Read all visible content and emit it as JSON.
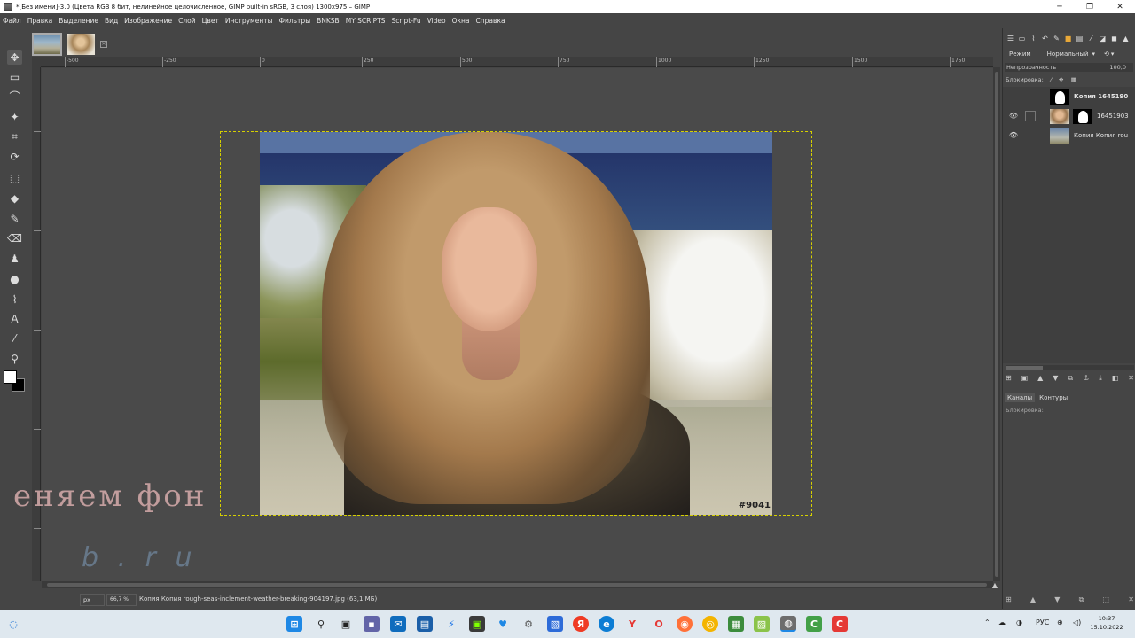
{
  "window": {
    "title": "*[Без имени]-3.0 (Цвета RGB 8 бит, нелинейное целочисленное, GIMP built-in sRGB, 3 слоя) 1300x975 – GIMP",
    "minimize": "─",
    "maximize": "❐",
    "close": "✕"
  },
  "menu": [
    "Файл",
    "Правка",
    "Выделение",
    "Вид",
    "Изображение",
    "Слой",
    "Цвет",
    "Инструменты",
    "Фильтры",
    "BNKSB",
    "MY SCRIPTS",
    "Script-Fu",
    "Video",
    "Окна",
    "Справка"
  ],
  "tab_close": "✕",
  "tools": [
    {
      "name": "move-tool-icon",
      "glyph": "✥"
    },
    {
      "name": "rect-select-icon",
      "glyph": "▭"
    },
    {
      "name": "free-select-icon",
      "glyph": "⌒"
    },
    {
      "name": "fuzzy-select-icon",
      "glyph": "✦"
    },
    {
      "name": "crop-icon",
      "glyph": "⌗"
    },
    {
      "name": "transform-icon",
      "glyph": "⟳"
    },
    {
      "name": "perspective-icon",
      "glyph": "⬚"
    },
    {
      "name": "bucket-fill-icon",
      "glyph": "◆"
    },
    {
      "name": "paintbrush-icon",
      "glyph": "✎"
    },
    {
      "name": "eraser-icon",
      "glyph": "⌫"
    },
    {
      "name": "clone-icon",
      "glyph": "♟"
    },
    {
      "name": "smudge-icon",
      "glyph": "●"
    },
    {
      "name": "path-icon",
      "glyph": "⌇"
    },
    {
      "name": "text-tool-icon",
      "glyph": "A"
    },
    {
      "name": "color-picker-icon",
      "glyph": "⁄"
    },
    {
      "name": "zoom-tool-icon",
      "glyph": "⚲"
    }
  ],
  "ruler_h_labels": [
    "-500",
    "-250",
    "0",
    "250",
    "500",
    "750",
    "1000",
    "1250",
    "1500",
    "1750"
  ],
  "canvas": {
    "watermark": "#9041",
    "overlay_line1": "еняем фон",
    "overlay_line2": "b . r u"
  },
  "status": {
    "unit": "px",
    "zoom": "66,7 %",
    "layer_info": "Копия Копия rough-seas-inclement-weather-breaking-904197.jpg (63,1 МБ)"
  },
  "dock": {
    "mode_label": "Режим",
    "mode_value": "Нормальный",
    "opacity_label": "Непрозрачность",
    "opacity_value": "100,0",
    "lock_label": "Блокировка:",
    "layers": [
      {
        "name": "Копия 1645190",
        "visible": false
      },
      {
        "name": "16451903",
        "visible": true
      },
      {
        "name": "Копия Копия rou",
        "visible": true
      }
    ],
    "sub_tabs": [
      "Каналы",
      "Контуры"
    ],
    "sub_lock_label": "Блокировка:"
  },
  "taskbar": {
    "lang": "РУС",
    "time": "10:37",
    "date": "15.10.2022"
  }
}
